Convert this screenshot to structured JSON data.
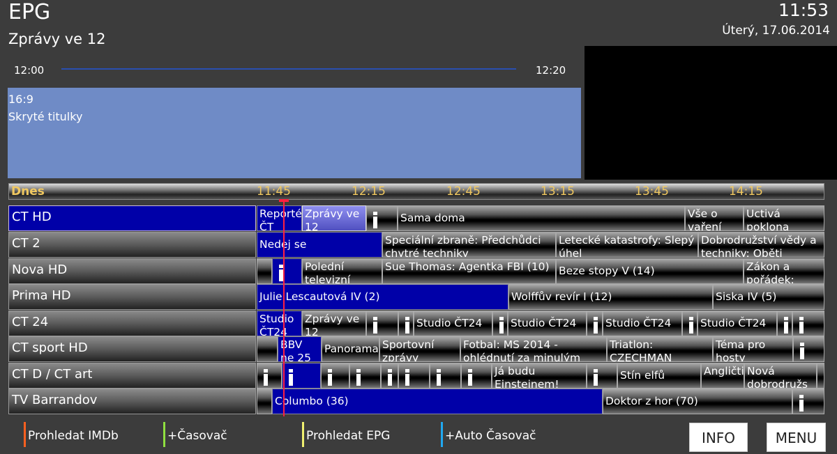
{
  "header": {
    "title": "EPG",
    "program": "Zprávy ve 12",
    "clock": "11:53",
    "date": "Úterý, 17.06.2014",
    "start": "12:00",
    "end": "12:20",
    "info_lines": [
      "16:9",
      "Skryté titulky"
    ]
  },
  "timeline": {
    "day": "Dnes",
    "ticks": [
      "11:45",
      "12:15",
      "12:45",
      "13:15",
      "13:45",
      "14:15"
    ],
    "now_color": "#ff2040"
  },
  "colors": {
    "selected": "#0000a8",
    "info_bg": "#6f8bc6"
  },
  "channels": [
    {
      "name": "CT HD",
      "selected": true,
      "programs": [
        {
          "t": "Reportéři ČT",
          "s": "blue"
        },
        {
          "t": "Zprávy ve 12",
          "s": "sel"
        },
        {
          "t": "i"
        },
        {
          "t": "Sama doma"
        },
        {
          "t": "Vše o vaření"
        },
        {
          "t": "Uctivá poklona"
        }
      ]
    },
    {
      "name": "CT 2",
      "programs": [
        {
          "t": "Nedej se",
          "s": "blue"
        },
        {
          "t": "Speciální zbraně: Předchůdci chytré techniky"
        },
        {
          "t": "Letecké katastrofy: Slepý úhel"
        },
        {
          "t": "Dobrodružství vědy a techniky: Oběti"
        }
      ]
    },
    {
      "name": "Nova HD",
      "programs": [
        {
          "t": ""
        },
        {
          "t": "i",
          "s": "blue"
        },
        {
          "t": "Polední televizní"
        },
        {
          "t": "Sue Thomas: Agentka FBI  (10)"
        },
        {
          "t": "Beze stopy V (14)"
        },
        {
          "t": "Zákon a pořádek:"
        }
      ]
    },
    {
      "name": "Prima HD",
      "programs": [
        {
          "t": "Julie Lescautová IV (2)",
          "s": "blue"
        },
        {
          "t": "Wolffův revír I (12)"
        },
        {
          "t": "Siska IV (5)"
        }
      ]
    },
    {
      "name": "CT 24",
      "programs": [
        {
          "t": "Studio ČT24",
          "s": "blue"
        },
        {
          "t": "Zprávy ve 12"
        },
        {
          "t": "i"
        },
        {
          "t": "i"
        },
        {
          "t": "Studio ČT24"
        },
        {
          "t": "i"
        },
        {
          "t": "Studio ČT24"
        },
        {
          "t": "i"
        },
        {
          "t": "Studio ČT24"
        },
        {
          "t": "i"
        },
        {
          "t": "Studio ČT24"
        },
        {
          "t": "i"
        },
        {
          "t": "i"
        }
      ]
    },
    {
      "name": "CT sport HD",
      "programs": [
        {
          "t": ""
        },
        {
          "t": "BBV ne 25",
          "s": "blue"
        },
        {
          "t": "Panorama"
        },
        {
          "t": "Sportovní zprávy"
        },
        {
          "t": "Fotbal: MS 2014 - ohlédnutí za minulým"
        },
        {
          "t": "Triatlon: CZECHMAN"
        },
        {
          "t": "Téma pro hosty"
        },
        {
          "t": "i"
        }
      ]
    },
    {
      "name": "CT D / CT art",
      "programs": [
        {
          "t": "i"
        },
        {
          "t": "i",
          "s": "blue"
        },
        {
          "t": "i"
        },
        {
          "t": "i"
        },
        {
          "t": "i"
        },
        {
          "t": "i"
        },
        {
          "t": "i"
        },
        {
          "t": "i"
        },
        {
          "t": "Já budu Einsteinem!"
        },
        {
          "t": "i"
        },
        {
          "t": "Stín elfů"
        },
        {
          "t": "Angličtina"
        },
        {
          "t": "Nová dobrodružs"
        },
        {
          "t": ""
        }
      ]
    },
    {
      "name": "TV Barrandov",
      "programs": [
        {
          "t": ""
        },
        {
          "t": "Columbo (36)",
          "s": "blue"
        },
        {
          "t": "Doktor z hor (70)"
        },
        {
          "t": "i"
        }
      ]
    }
  ],
  "footer": {
    "keys": [
      {
        "label": "Prohledat IMDb",
        "color": "#ff6020"
      },
      {
        "label": "+Časovač",
        "color": "#90e040"
      },
      {
        "label": "Prohledat EPG",
        "color": "#f0f070"
      },
      {
        "label": "+Auto Časovač",
        "color": "#20a8f0"
      }
    ],
    "info": "INFO",
    "menu": "MENU"
  }
}
